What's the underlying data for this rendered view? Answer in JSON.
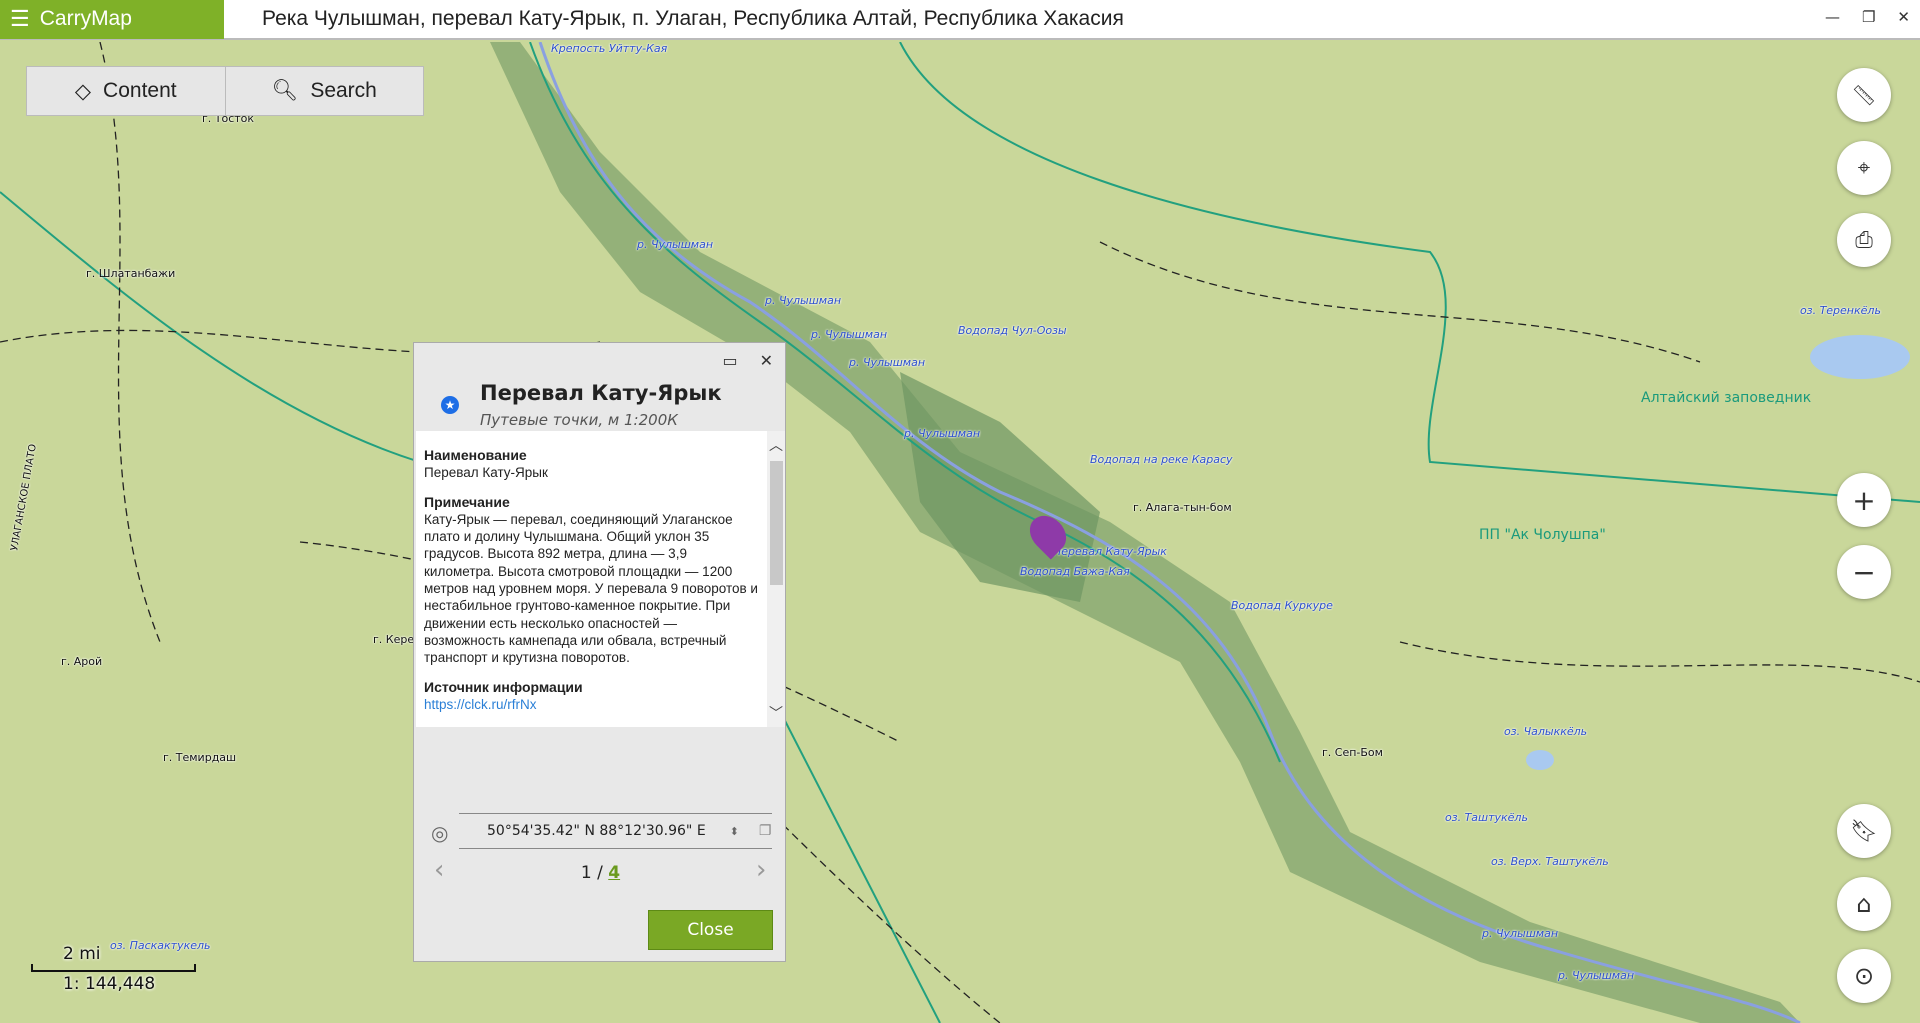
{
  "app": {
    "name": "CarryMap",
    "window_title": "Река Чулышман, перевал Кату-Ярык, п. Улаган, Республика Алтай, Республика Хакасия",
    "accent": "#7fb128"
  },
  "toolbar": {
    "content_label": "Content",
    "search_label": "Search"
  },
  "map": {
    "labels": [
      {
        "text": "Крепость Уйтту-Кая",
        "kind": "poi"
      },
      {
        "text": "г. Тосток",
        "kind": "peak"
      },
      {
        "text": "г. Шлатанбажи",
        "kind": "peak"
      },
      {
        "text": "р. Чулышман",
        "kind": "river"
      },
      {
        "text": "р. Чулышман",
        "kind": "river"
      },
      {
        "text": "р. Чулышман",
        "kind": "river"
      },
      {
        "text": "р. Чулышман",
        "kind": "river"
      },
      {
        "text": "р. Чулышман",
        "kind": "river"
      },
      {
        "text": "Водопад Чул-Оозы",
        "kind": "poi"
      },
      {
        "text": "Водопад на реке Карасу",
        "kind": "poi"
      },
      {
        "text": "г. Алага-тын-бом",
        "kind": "peak"
      },
      {
        "text": "Перевал Кату-Ярык",
        "kind": "poi"
      },
      {
        "text": "Водопад Бажа-Кая",
        "kind": "poi"
      },
      {
        "text": "Водопад Куркуре",
        "kind": "poi"
      },
      {
        "text": "г. Сеп-Бом",
        "kind": "peak"
      },
      {
        "text": "оз. Теренкёль",
        "kind": "lake"
      },
      {
        "text": "Алтайский заповедник",
        "kind": "area"
      },
      {
        "text": "ПП \"Ак Чолушпа\"",
        "kind": "area"
      },
      {
        "text": "оз. Чалыккёль",
        "kind": "lake"
      },
      {
        "text": "оз. Таштукёль",
        "kind": "lake"
      },
      {
        "text": "оз. Верх. Таштукёль",
        "kind": "lake"
      },
      {
        "text": "р. Чулышман",
        "kind": "river"
      },
      {
        "text": "р. Чулышман",
        "kind": "river"
      },
      {
        "text": "г. Арой",
        "kind": "peak"
      },
      {
        "text": "г. Темирдаш",
        "kind": "peak"
      },
      {
        "text": "г. Керены",
        "kind": "peak"
      },
      {
        "text": "оз. Паскактукель",
        "kind": "lake"
      },
      {
        "text": "УЛАГАНСКОЕ ПЛАТО",
        "kind": "region"
      }
    ],
    "scale": {
      "distance": "2 mi",
      "ratio": "1: 144,448"
    }
  },
  "right_controls": [
    "ruler-icon",
    "add-place-icon",
    "print-icon",
    "zoom-in-icon",
    "zoom-out-icon",
    "bookmark-icon",
    "home-icon",
    "my-location-icon"
  ],
  "popup": {
    "title": "Перевал Кату-Ярык",
    "subtitle": "Путевые точки, м 1:200К",
    "fields": [
      {
        "label": "Наименование",
        "value": "Перевал Кату-Ярык"
      },
      {
        "label": "Примечание",
        "value": "Кату-Ярык — перевал, соединяющий Улаганское плато и долину Чулышмана. Общий уклон 35 градусов. Высота 892 метра, длина — 3,9 километра. Высота смотровой площадки — 1200 метров над уровнем моря. У перевала 9 поворотов и нестабильное грунтово-каменное покрытие. При движении есть несколько опасностей — возможность камнепада или обвала, встречный транспорт и крутизна поворотов."
      },
      {
        "label": "Источник информации",
        "value": "https://clck.ru/rfrNx"
      }
    ],
    "coordinates": "50°54'35.42\" N 88°12'30.96\" E",
    "page_current": "1 / ",
    "page_total": "4",
    "close_label": "Close"
  }
}
